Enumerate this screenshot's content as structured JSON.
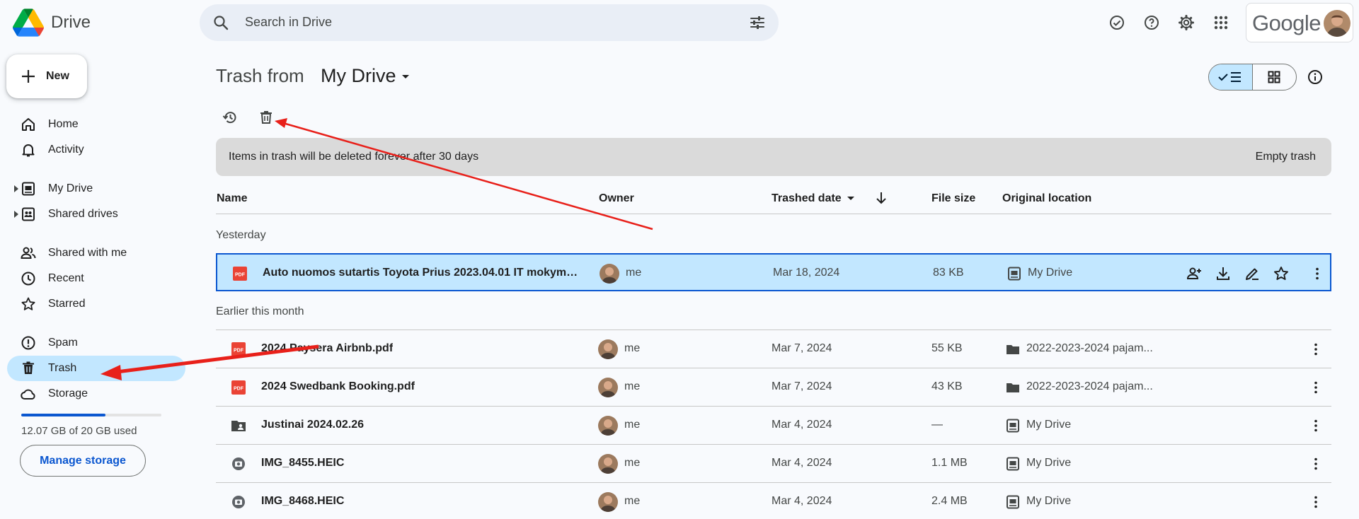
{
  "app": {
    "name": "Drive"
  },
  "search": {
    "placeholder": "Search in Drive"
  },
  "account": {
    "brand": "Google"
  },
  "sidebar": {
    "new_label": "New",
    "items": [
      {
        "label": "Home",
        "icon": "home-icon"
      },
      {
        "label": "Activity",
        "icon": "bell-icon"
      },
      {
        "label": "My Drive",
        "icon": "my-drive-icon"
      },
      {
        "label": "Shared drives",
        "icon": "shared-drives-icon"
      },
      {
        "label": "Shared with me",
        "icon": "people-icon"
      },
      {
        "label": "Recent",
        "icon": "clock-icon"
      },
      {
        "label": "Starred",
        "icon": "star-icon"
      },
      {
        "label": "Spam",
        "icon": "spam-icon"
      },
      {
        "label": "Trash",
        "icon": "trash-icon"
      },
      {
        "label": "Storage",
        "icon": "cloud-icon"
      }
    ],
    "active": "Trash",
    "storage": {
      "text": "12.07 GB of 20 GB used",
      "used_fraction": 0.6035
    },
    "manage_storage_label": "Manage storage"
  },
  "main": {
    "title_prefix": "Trash from",
    "title_location": "My Drive",
    "banner": {
      "text": "Items in trash will be deleted forever after 30 days",
      "action": "Empty trash"
    },
    "columns": {
      "name": "Name",
      "owner": "Owner",
      "trashed_date": "Trashed date",
      "file_size": "File size",
      "original_location": "Original location"
    },
    "sections": [
      {
        "label": "Yesterday",
        "rows": [
          {
            "name": "Auto nuomos sutartis  Toyota Prius 2023.04.01 IT mokymų ...",
            "type": "pdf",
            "owner": "me",
            "date": "Mar 18, 2024",
            "size": "83 KB",
            "location": "My Drive",
            "location_icon": "my-drive-icon",
            "selected": true
          }
        ]
      },
      {
        "label": "Earlier this month",
        "rows": [
          {
            "name": "2024 Paysera Airbnb.pdf",
            "type": "pdf",
            "owner": "me",
            "date": "Mar 7, 2024",
            "size": "55 KB",
            "location": "2022-2023-2024 pajam...",
            "location_icon": "folder-icon"
          },
          {
            "name": "2024 Swedbank Booking.pdf",
            "type": "pdf",
            "owner": "me",
            "date": "Mar 7, 2024",
            "size": "43 KB",
            "location": "2022-2023-2024 pajam...",
            "location_icon": "folder-icon"
          },
          {
            "name": "Justinai 2024.02.26",
            "type": "shared-folder",
            "owner": "me",
            "date": "Mar 4, 2024",
            "size": "—",
            "location": "My Drive",
            "location_icon": "my-drive-icon"
          },
          {
            "name": "IMG_8455.HEIC",
            "type": "image",
            "owner": "me",
            "date": "Mar 4, 2024",
            "size": "1.1 MB",
            "location": "My Drive",
            "location_icon": "my-drive-icon"
          },
          {
            "name": "IMG_8468.HEIC",
            "type": "image",
            "owner": "me",
            "date": "Mar 4, 2024",
            "size": "2.4 MB",
            "location": "My Drive",
            "location_icon": "my-drive-icon"
          }
        ]
      }
    ]
  },
  "colors": {
    "accent": "#0b57d0",
    "selected_bg": "#c2e7ff",
    "annotation_arrow": "#e8201a",
    "pdf_red": "#ea4335"
  }
}
